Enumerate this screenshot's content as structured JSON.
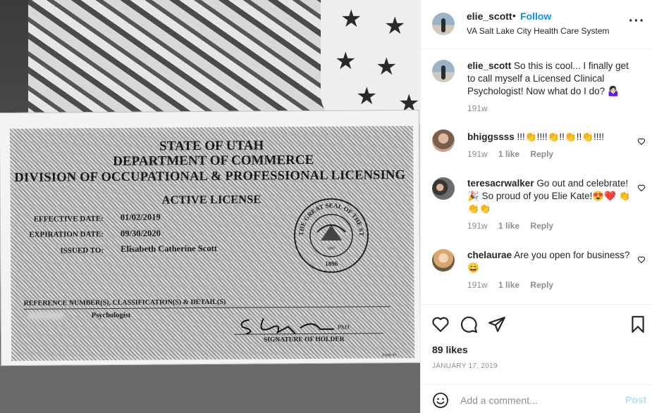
{
  "post": {
    "author": "elie_scott",
    "follow_label": "Follow",
    "separator": "•",
    "location": "VA Salt Lake City Health Care System",
    "more_icon": "more-horizontal-icon",
    "caption": {
      "username": "elie_scott",
      "text": "So this is cool... I finally get to call myself a Licensed Clinical Psychologist! Now what do I do? 🤷🏻‍♀️",
      "time": "191w"
    }
  },
  "photo": {
    "certificate": {
      "state": "STATE OF UTAH",
      "department": "DEPARTMENT OF COMMERCE",
      "division": "DIVISION OF OCCUPATIONAL & PROFESSIONAL LICENSING",
      "status": "ACTIVE LICENSE",
      "effective_label": "EFFECTIVE DATE:",
      "effective_value": "01/02/2019",
      "expiration_label": "EXPIRATION DATE:",
      "expiration_value": "09/30/2020",
      "issued_label": "ISSUED TO:",
      "issued_value": "Elisabeth Catherine Scott",
      "reference_label": "REFERENCE NUMBER(S), CLASSIFICATION(S) & DETAIL(S)",
      "classification": "Psychologist",
      "signature_label": "SIGNATURE OF HOLDER",
      "seal_text": "THE GREAT SEAL OF THE STATE OF UTAH",
      "seal_year": "1896",
      "seal_inner_year": "1847",
      "signature_suffix": "PhD",
      "form_label": "Form #1"
    }
  },
  "comments": [
    {
      "username": "bhiggssss",
      "text": "!!!👏!!!!👏!!👏!!👏!!!!",
      "time": "191w",
      "likes": "1 like",
      "reply": "Reply"
    },
    {
      "username": "teresacrwalker",
      "text": "Go out and celebrate! 🎉 So proud of you Elie Kate!😍❤️ 👏👏👏",
      "time": "191w",
      "likes": "1 like",
      "reply": "Reply"
    },
    {
      "username": "chelaurae",
      "text": "Are you open for business? 😄",
      "time": "191w",
      "likes": "1 like",
      "reply": "Reply"
    }
  ],
  "actions": {
    "like_icon": "heart-icon",
    "comment_icon": "comment-icon",
    "share_icon": "share-icon",
    "save_icon": "bookmark-icon",
    "likes": "89 likes",
    "date": "JANUARY 17, 2019"
  },
  "add_comment": {
    "emoji_icon": "emoji-icon",
    "placeholder": "Add a comment...",
    "post_label": "Post"
  },
  "colors": {
    "link_blue": "#0095f6",
    "muted": "#8e8e8e",
    "post_disabled": "#b2dffc",
    "border": "#efefef"
  }
}
